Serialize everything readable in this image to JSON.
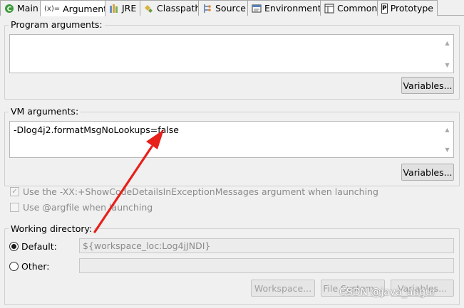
{
  "tabs": [
    {
      "label": "Main",
      "icon": "main-launch-icon"
    },
    {
      "label": "Arguments",
      "icon": "arguments-icon",
      "icon_text": "(x)="
    },
    {
      "label": "JRE",
      "icon": "jre-library-icon"
    },
    {
      "label": "Classpath",
      "icon": "classpath-icon"
    },
    {
      "label": "Source",
      "icon": "source-icon"
    },
    {
      "label": "Environment",
      "icon": "environment-icon"
    },
    {
      "label": "Common",
      "icon": "common-icon"
    },
    {
      "label": "Prototype",
      "icon": "prototype-icon",
      "icon_text": "P"
    }
  ],
  "program_args": {
    "label": "Program arguments:",
    "value": "",
    "variables_button": "Variables..."
  },
  "vm_args": {
    "label": "VM arguments:",
    "value": "-Dlog4j2.formatMsgNoLookups=false",
    "variables_button": "Variables..."
  },
  "options": {
    "show_code_details": "Use the -XX:+ShowCodeDetailsInExceptionMessages argument when launching",
    "show_code_details_checked": true,
    "argfile": "Use @argfile when launching",
    "argfile_checked": false
  },
  "working_directory": {
    "label": "Working directory:",
    "default_label": "Default:",
    "default_value": "${workspace_loc:Log4jJNDI}",
    "other_label": "Other:",
    "other_value": "",
    "selected": "default",
    "workspace_button": "Workspace...",
    "filesystem_button": "File System...",
    "variables_button": "Variables..."
  },
  "colors": {
    "annotation_arrow": "#e8201a",
    "checked_text": "#8a8a8a"
  },
  "watermark": "CSDN @java_augur"
}
